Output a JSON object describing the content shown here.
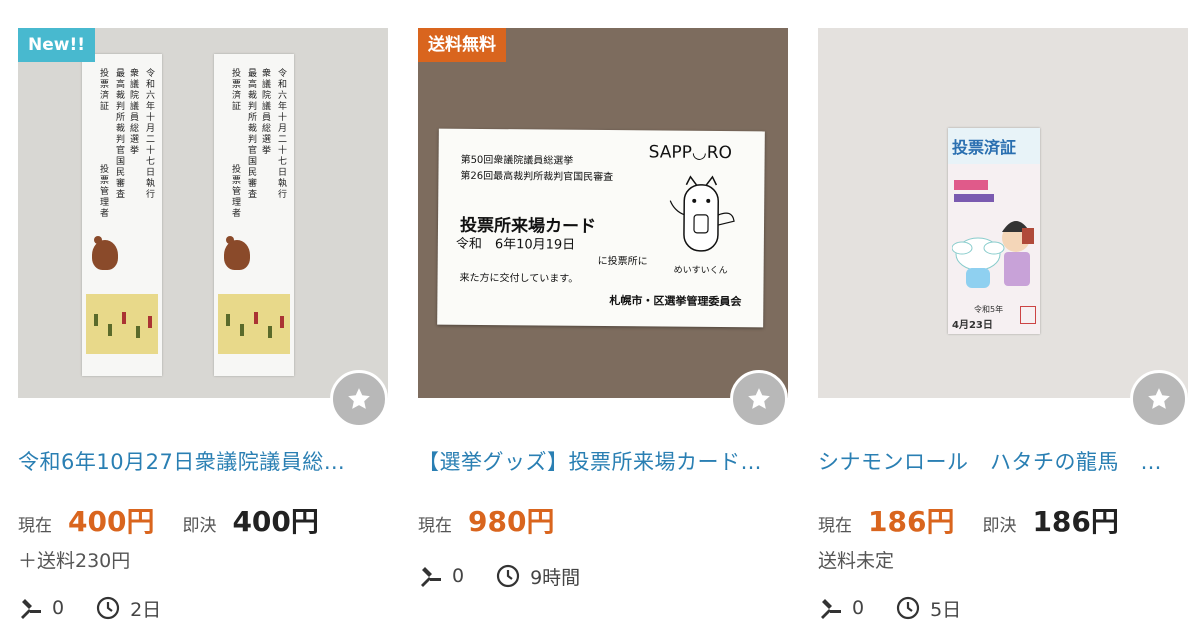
{
  "items": [
    {
      "badge": "New!!",
      "title": "令和6年10月27日衆議院議員総…",
      "price_label": "現在",
      "price": "400円",
      "buy_label": "即決",
      "buy_price": "400円",
      "shipping": "＋送料230円",
      "bids": "0",
      "time_left": "2日",
      "image": {
        "ticket_text_1": "令和六年十月二十七日執行",
        "ticket_text_2": "衆議院議員総選挙",
        "ticket_text_3": "最高裁判所裁判官国民審査",
        "ticket_text_4": "投票済証",
        "ticket_text_5": "投票管理者"
      }
    },
    {
      "badge": "送料無料",
      "title": "【選挙グッズ】投票所来場カード…",
      "price_label": "現在",
      "price": "980円",
      "bids": "0",
      "time_left": "9時間",
      "image": {
        "line1": "第50回衆議院議員総選挙",
        "line2": "第26回最高裁判所裁判官国民審査",
        "heading": "投票所来場カード",
        "date": "令和　6年10月19日",
        "line3": "に投票所に",
        "line4": "来た方に交付しています。",
        "logo": "SAPP◡RO",
        "mascot": "めいすいくん",
        "issuer": "札幌市・区選挙管理委員会"
      }
    },
    {
      "title": "シナモンロール　ハタチの龍馬　…",
      "price_label": "現在",
      "price": "186円",
      "buy_label": "即決",
      "buy_price": "186円",
      "shipping": "送料未定",
      "bids": "0",
      "time_left": "5日",
      "image": {
        "heading": "投票済証",
        "era": "令和5年",
        "date": "4月23日"
      }
    }
  ],
  "colors": {
    "accent": "#d9651e",
    "title": "#2a7fb3",
    "new_badge": "#48b9cf"
  },
  "icons": {
    "favorite": "star-icon",
    "bids": "gavel-icon",
    "time": "clock-icon"
  }
}
